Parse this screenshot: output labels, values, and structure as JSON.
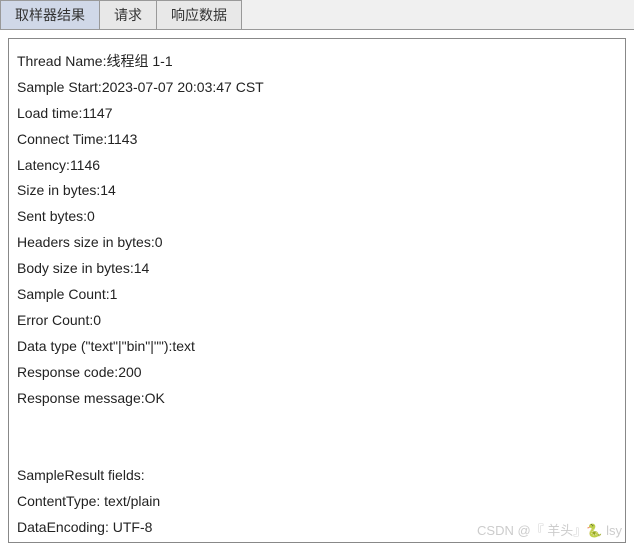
{
  "tabs": {
    "sampler_result": "取样器结果",
    "request": "请求",
    "response_data": "响应数据"
  },
  "result": {
    "thread_name_label": "Thread Name:",
    "thread_name_value": "线程组 1-1",
    "sample_start_label": "Sample Start:",
    "sample_start_value": "2023-07-07 20:03:47 CST",
    "load_time_label": "Load time:",
    "load_time_value": "1147",
    "connect_time_label": "Connect Time:",
    "connect_time_value": "1143",
    "latency_label": "Latency:",
    "latency_value": "1146",
    "size_in_bytes_label": "Size in bytes:",
    "size_in_bytes_value": "14",
    "sent_bytes_label": "Sent bytes:",
    "sent_bytes_value": "0",
    "headers_size_label": "Headers size in bytes:",
    "headers_size_value": "0",
    "body_size_label": "Body size in bytes:",
    "body_size_value": "14",
    "sample_count_label": "Sample Count:",
    "sample_count_value": "1",
    "error_count_label": "Error Count:",
    "error_count_value": "0",
    "data_type_label": "Data type (\"text\"|\"bin\"|\"\"):",
    "data_type_value": "text",
    "response_code_label": "Response code:",
    "response_code_value": "200",
    "response_message_label": "Response message:",
    "response_message_value": "OK",
    "sampleresult_fields_label": "SampleResult fields:",
    "content_type_label": "ContentType: ",
    "content_type_value": "text/plain",
    "data_encoding_label": "DataEncoding: ",
    "data_encoding_value": "UTF-8"
  },
  "watermark": "CSDN @『 羊头』🐍 lsy"
}
